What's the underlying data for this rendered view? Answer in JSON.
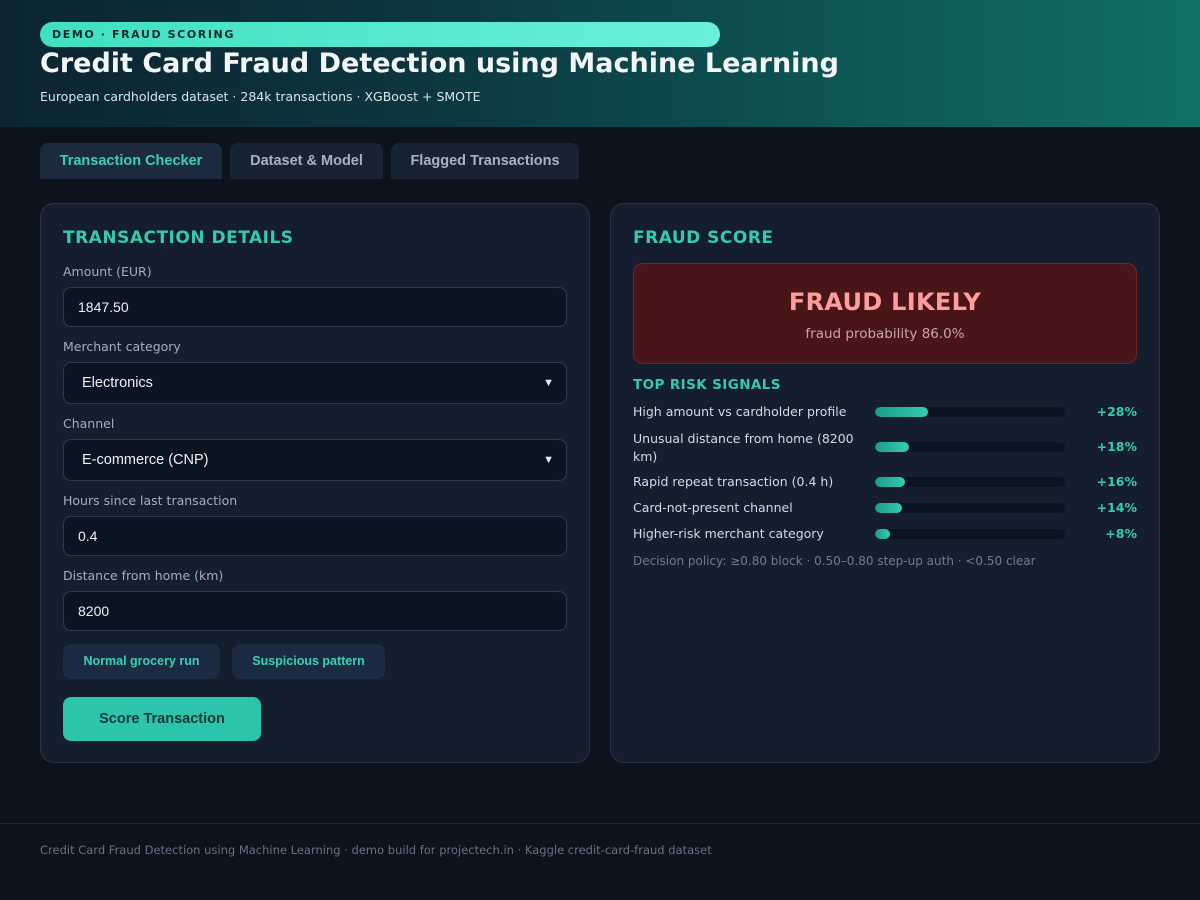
{
  "header": {
    "badge": "DEMO · FRAUD SCORING",
    "title": "Credit Card Fraud Detection using Machine Learning",
    "subtitle": "European cardholders dataset · 284k transactions · XGBoost + SMOTE"
  },
  "tabs": [
    {
      "label": "Transaction Checker",
      "active": true
    },
    {
      "label": "Dataset & Model",
      "active": false
    },
    {
      "label": "Flagged Transactions",
      "active": false
    }
  ],
  "form": {
    "heading": "TRANSACTION DETAILS",
    "amount_label": "Amount (EUR)",
    "amount_value": "1847.50",
    "merchant_label": "Merchant category",
    "merchant_value": "Electronics",
    "channel_label": "Channel",
    "channel_value": "E-commerce (CNP)",
    "hours_label": "Hours since last transaction",
    "hours_value": "0.4",
    "distance_label": "Distance from home (km)",
    "distance_value": "8200",
    "preset_normal": "Normal grocery run",
    "preset_suspicious": "Suspicious pattern",
    "score_button": "Score Transaction",
    "chevron_icon": "chevron-down-icon"
  },
  "result": {
    "heading": "FRAUD SCORE",
    "verdict": "FRAUD LIKELY",
    "probability_text": "fraud probability 86.0%",
    "verdict_color": "#ff9d9d",
    "verdict_bg": "#4a1519",
    "signals_heading": "TOP RISK SIGNALS",
    "signals": [
      {
        "label": "High amount vs cardholder profile",
        "value": "+28%",
        "fill": 0.28
      },
      {
        "label": "Unusual distance from home (8200 km)",
        "value": "+18%",
        "fill": 0.18
      },
      {
        "label": "Rapid repeat transaction (0.4 h)",
        "value": "+16%",
        "fill": 0.16
      },
      {
        "label": "Card-not-present channel",
        "value": "+14%",
        "fill": 0.14
      },
      {
        "label": "Higher-risk merchant category",
        "value": "+8%",
        "fill": 0.08
      }
    ],
    "policy": "Decision policy: ≥0.80 block · 0.50–0.80 step-up auth · <0.50 clear"
  },
  "footer": {
    "text": "Credit Card Fraud Detection using Machine Learning · demo build for projectech.in · Kaggle credit-card-fraud dataset"
  },
  "colors": {
    "accent": "#37c9b0",
    "background": "#0d131d",
    "card": "#141e2e"
  }
}
